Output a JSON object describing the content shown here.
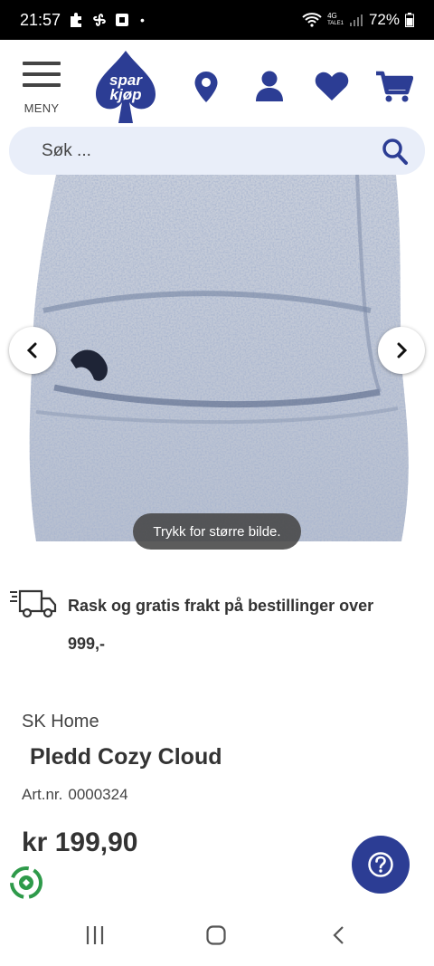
{
  "status_bar": {
    "time": "21:57",
    "dot": "•",
    "network": "4G",
    "network_sub": "TALE1",
    "battery": "72%"
  },
  "header": {
    "menu_label": "MENY",
    "logo_text_top": "spar",
    "logo_text_bottom": "kjøp"
  },
  "search": {
    "placeholder": "Søk ..."
  },
  "gallery": {
    "toast": "Trykk for større bilde."
  },
  "shipping": {
    "text": "Rask og gratis frakt på bestillinger over 999,-"
  },
  "product": {
    "brand": "SK Home",
    "title": "Pledd Cozy Cloud",
    "artnr_label": "Art.nr.",
    "artnr_value": "0000324",
    "price": "kr 199,90"
  },
  "colors": {
    "brand_blue": "#2c3d94",
    "search_bg": "#e9eef9",
    "text": "#333333"
  }
}
